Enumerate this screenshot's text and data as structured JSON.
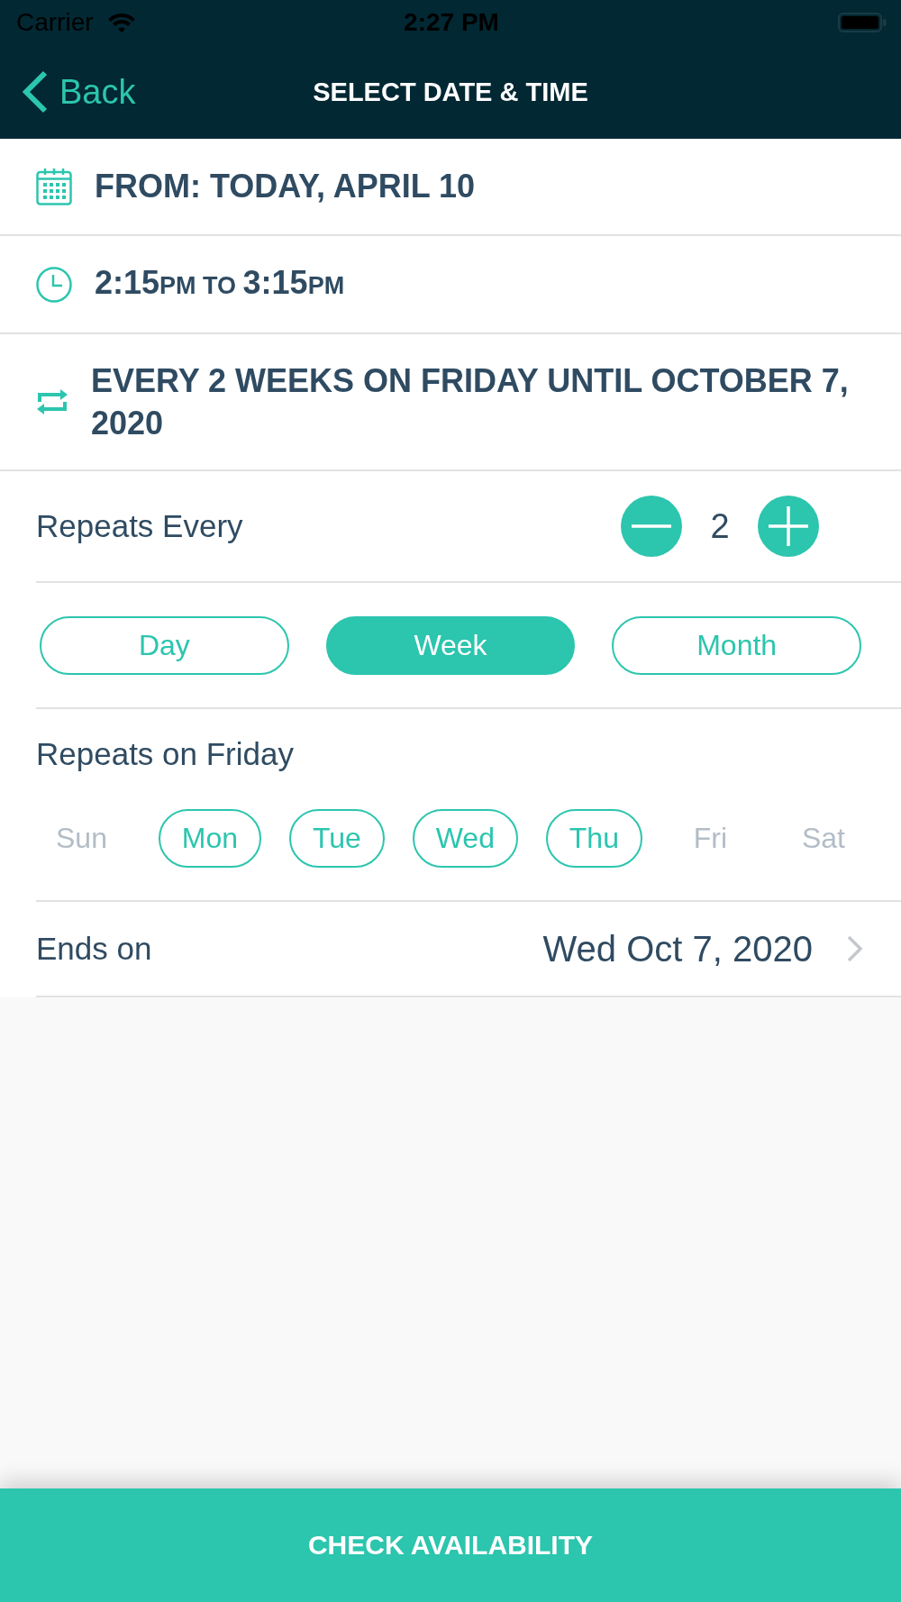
{
  "status_bar": {
    "carrier": "Carrier",
    "time": "2:27 PM"
  },
  "nav_bar": {
    "back_label": "Back",
    "title": "SELECT DATE & TIME"
  },
  "summary": [
    {
      "kind": "date",
      "text": "FROM: TODAY, APRIL 10"
    },
    {
      "kind": "time",
      "parts": [
        {
          "kind": "time",
          "text": "2:15"
        },
        {
          "kind": "unit",
          "text": "PM TO "
        },
        {
          "kind": "time",
          "text": "3:15"
        },
        {
          "kind": "unit",
          "text": "PM"
        }
      ]
    },
    {
      "kind": "repeat",
      "text": "EVERY 2 WEEKS ON FRIDAY UNTIL OCTOBER 7, 2020"
    }
  ],
  "repeats_every": {
    "label": "Repeats Every",
    "value": "2"
  },
  "units": [
    {
      "label": "Day",
      "selected": false
    },
    {
      "label": "Week",
      "selected": true
    },
    {
      "label": "Month",
      "selected": false
    }
  ],
  "repeats_on": {
    "label": "Repeats on Friday",
    "days": [
      {
        "label": "Sun",
        "disabled": true
      },
      {
        "label": "Mon",
        "disabled": false
      },
      {
        "label": "Tue",
        "disabled": false
      },
      {
        "label": "Wed",
        "disabled": false
      },
      {
        "label": "Thu",
        "disabled": false
      },
      {
        "label": "Fri",
        "disabled": true
      },
      {
        "label": "Sat",
        "disabled": true
      }
    ]
  },
  "ends_on": {
    "label": "Ends on",
    "value": "Wed Oct 7, 2020"
  },
  "action_button": {
    "label": "CHECK AVAILABILITY"
  }
}
